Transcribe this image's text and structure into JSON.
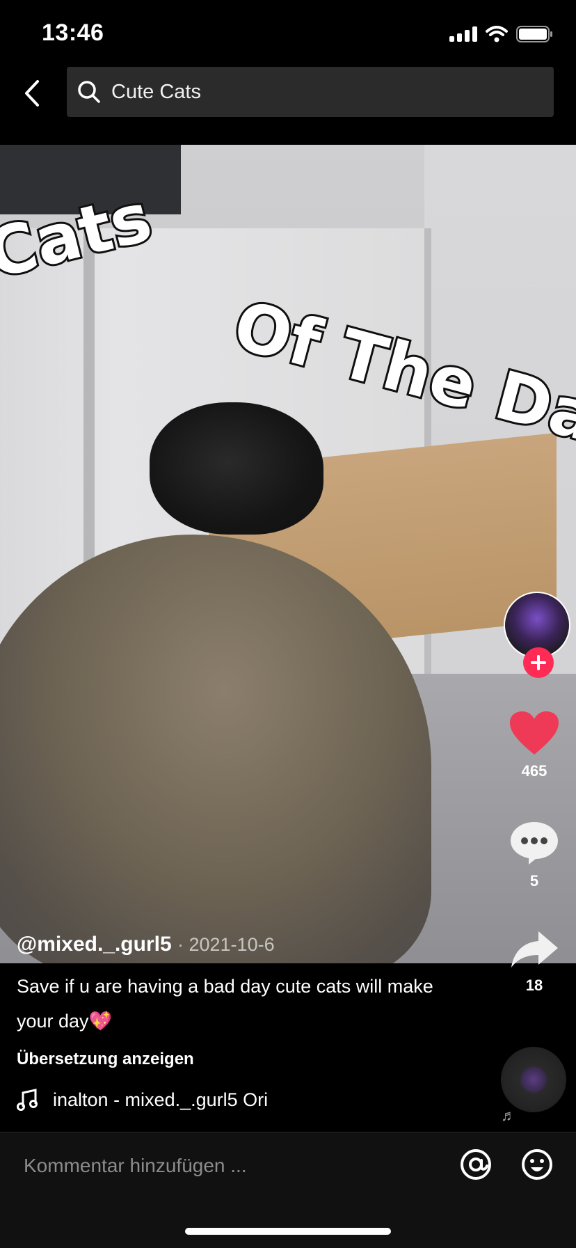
{
  "status_bar": {
    "time": "13:46",
    "icons": [
      "signal-icon",
      "wifi-icon",
      "battery-icon"
    ]
  },
  "search": {
    "query": "Cute Cats",
    "icons": [
      "back-icon",
      "search-icon"
    ]
  },
  "video": {
    "overlay_text_line1": "Cats",
    "overlay_text_line2": "Of The Da"
  },
  "actions": {
    "likes": "465",
    "comments": "5",
    "shares": "18",
    "accent_color": "#fe2c55"
  },
  "post": {
    "username": "@mixed._.gurl5",
    "date": "· 2021-10-6",
    "description": "Save if u are having a bad day cute cats will make your day💖",
    "translate_label": "Übersetzung anzeigen",
    "music": "inalton - mixed._.gurl5    Ori"
  },
  "comment_bar": {
    "placeholder": "Kommentar hinzufügen ...",
    "icons": [
      "mention-icon",
      "emoji-icon"
    ]
  }
}
